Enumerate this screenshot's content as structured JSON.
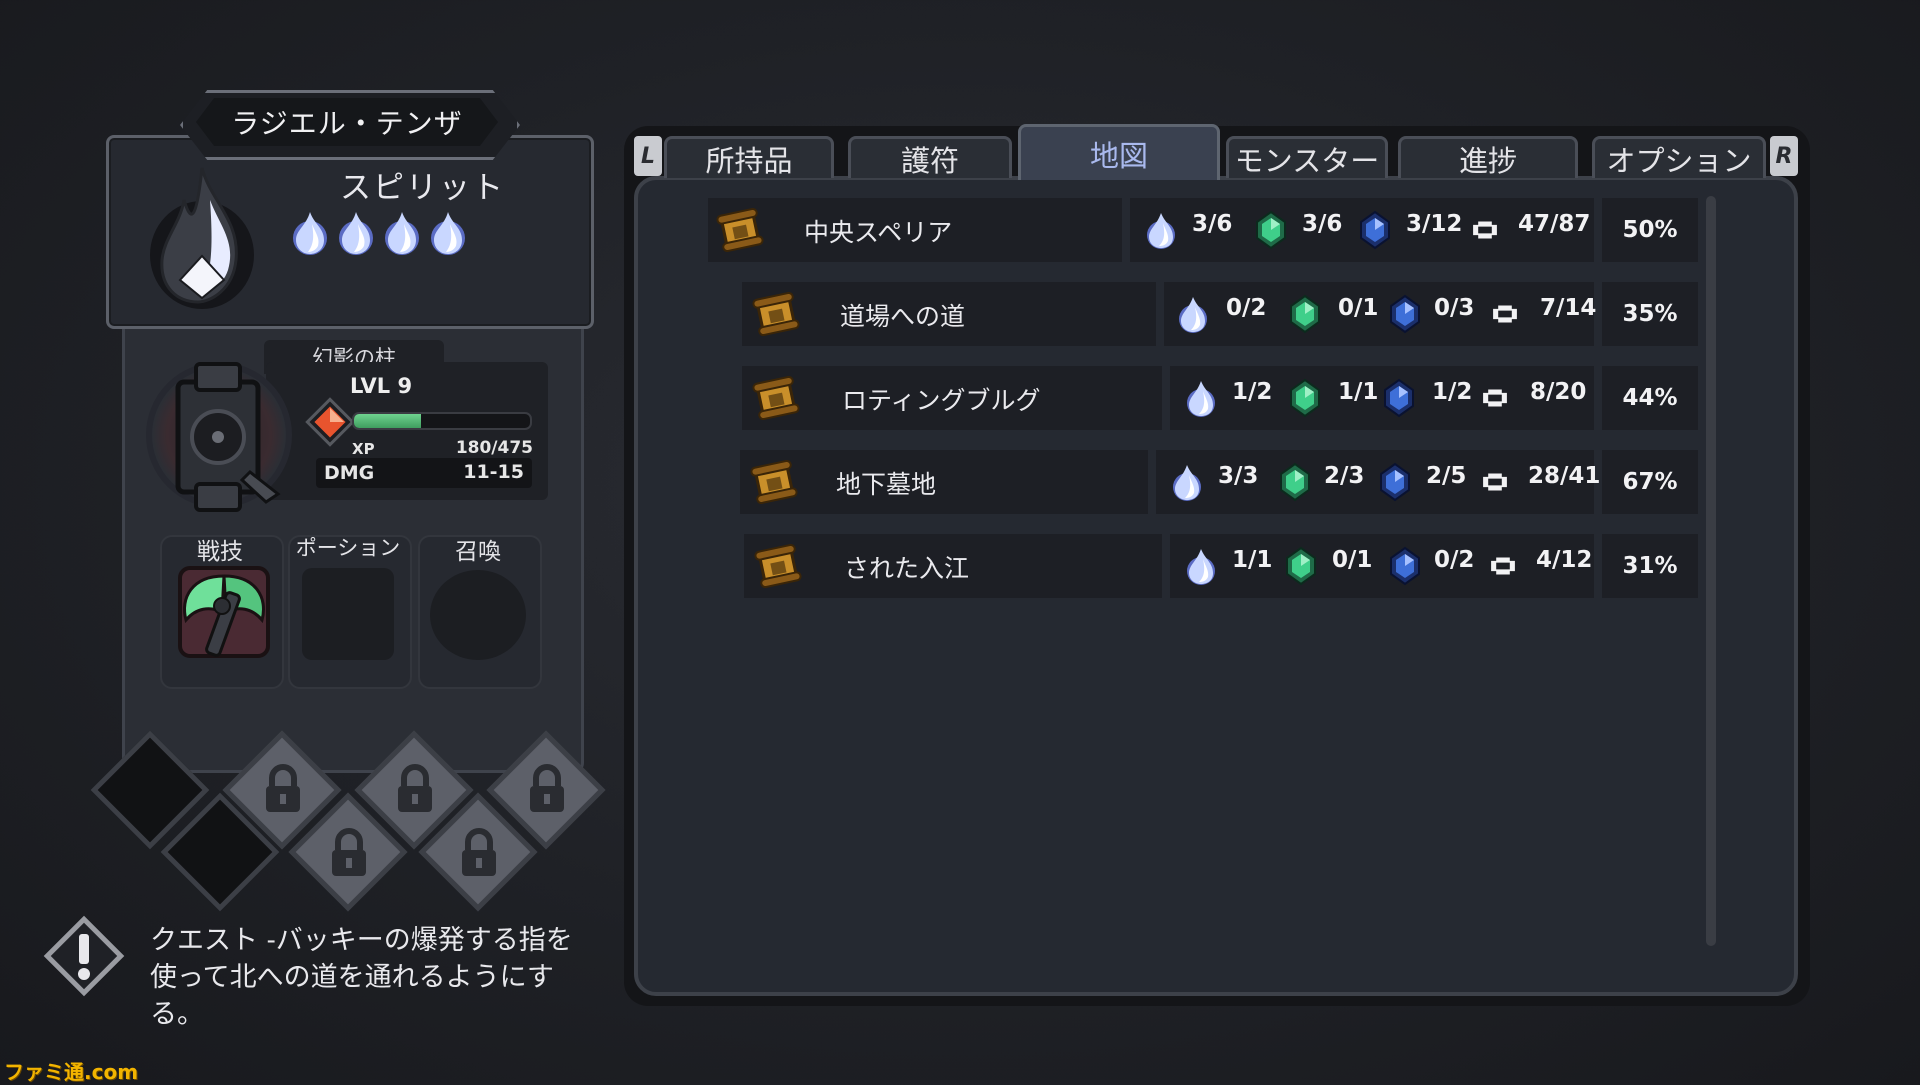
{
  "character": {
    "name": "ラジエル・テンザ",
    "spirit_label": "スピリット",
    "spirit_pips": 4
  },
  "weapon": {
    "name": "幻影の柱",
    "level_label": "LVL",
    "level": "9",
    "xp_label": "XP",
    "xp_value": "180/475",
    "xp_fraction": 0.38,
    "dmg_label": "DMG",
    "dmg_value": "11-15"
  },
  "slots": [
    {
      "label": "戦技",
      "filled": true
    },
    {
      "label": "ポーション",
      "filled": false
    },
    {
      "label": "召喚",
      "filled": false
    }
  ],
  "quest": {
    "text": "クエスト -バッキーの爆発する指を使って北への道を通れるようにする。"
  },
  "watermark": "ファミ通.com",
  "tabs": {
    "left_shoulder": "L",
    "right_shoulder": "R",
    "items": [
      "所持品",
      "護符",
      "地図",
      "モンスター",
      "進捗",
      "オプション"
    ],
    "active": "地図"
  },
  "map_areas": [
    {
      "name": "中央スペリア",
      "spirit": "3/6",
      "green": "3/6",
      "blue": "3/12",
      "rooms": "47/87",
      "percent": "50%",
      "icon": "map-scroll-icon"
    },
    {
      "name": "道場への道",
      "spirit": "0/2",
      "green": "0/1",
      "blue": "0/3",
      "rooms": "7/14",
      "percent": "35%",
      "icon": "scroll-icon"
    },
    {
      "name": "ロティングブルグ",
      "spirit": "1/2",
      "green": "1/1",
      "blue": "1/2",
      "rooms": "8/20",
      "percent": "44%",
      "icon": "scroll-icon"
    },
    {
      "name": "地下墓地",
      "spirit": "3/3",
      "green": "2/3",
      "blue": "2/5",
      "rooms": "28/41",
      "percent": "67%",
      "icon": "scroll-icon"
    },
    {
      "name": "された入江",
      "spirit": "1/1",
      "green": "0/1",
      "blue": "0/2",
      "rooms": "4/12",
      "percent": "31%",
      "icon": "scroll-icon"
    }
  ],
  "colors": {
    "accent_tab_text": "#a9b9ee",
    "spirit_flame": "#c9d7ff",
    "green_gem": "#3fcf8a",
    "blue_gem": "#3e6fd8",
    "xp_fill": "#5ec37e"
  }
}
